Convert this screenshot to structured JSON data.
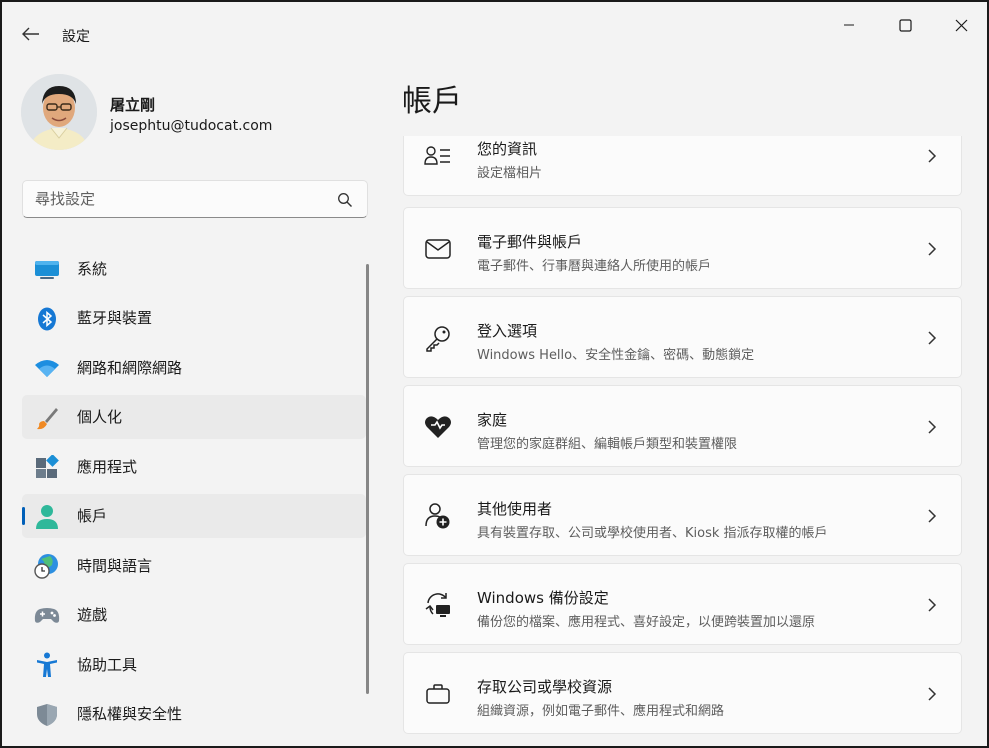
{
  "window": {
    "title": "設定"
  },
  "profile": {
    "name": "屠立剛",
    "email": "josephtu@tudocat.com"
  },
  "search": {
    "placeholder": "尋找設定"
  },
  "nav": {
    "items": [
      {
        "label": "系統",
        "icon": "monitor-icon"
      },
      {
        "label": "藍牙與裝置",
        "icon": "bluetooth-icon"
      },
      {
        "label": "網路和網際網路",
        "icon": "wifi-icon"
      },
      {
        "label": "個人化",
        "icon": "brush-icon"
      },
      {
        "label": "應用程式",
        "icon": "apps-icon"
      },
      {
        "label": "帳戶",
        "icon": "person-icon"
      },
      {
        "label": "時間與語言",
        "icon": "globe-clock-icon"
      },
      {
        "label": "遊戲",
        "icon": "gamepad-icon"
      },
      {
        "label": "協助工具",
        "icon": "accessibility-icon"
      },
      {
        "label": "隱私權與安全性",
        "icon": "shield-icon"
      }
    ]
  },
  "main": {
    "title": "帳戶",
    "cards": [
      {
        "title": "您的資訊",
        "subtitle": "設定檔相片",
        "icon": "person-info-icon"
      },
      {
        "title": "電子郵件與帳戶",
        "subtitle": "電子郵件、行事曆與連絡人所使用的帳戶",
        "icon": "mail-icon"
      },
      {
        "title": "登入選項",
        "subtitle": "Windows Hello、安全性金鑰、密碼、動態鎖定",
        "icon": "key-icon"
      },
      {
        "title": "家庭",
        "subtitle": "管理您的家庭群組、編輯帳戶類型和裝置權限",
        "icon": "family-heart-icon"
      },
      {
        "title": "其他使用者",
        "subtitle": "具有裝置存取、公司或學校使用者、Kiosk 指派存取權的帳戶",
        "icon": "person-add-icon"
      },
      {
        "title": "Windows 備份設定",
        "subtitle": "備份您的檔案、應用程式、喜好設定，以便跨裝置加以還原",
        "icon": "backup-sync-icon"
      },
      {
        "title": "存取公司或學校資源",
        "subtitle": "組織資源，例如電子郵件、應用程式和網路",
        "icon": "briefcase-icon"
      }
    ]
  },
  "colors": {
    "accent": "#005fb8",
    "window_bg": "#f3f3f3",
    "card_bg": "#fbfbfb"
  }
}
